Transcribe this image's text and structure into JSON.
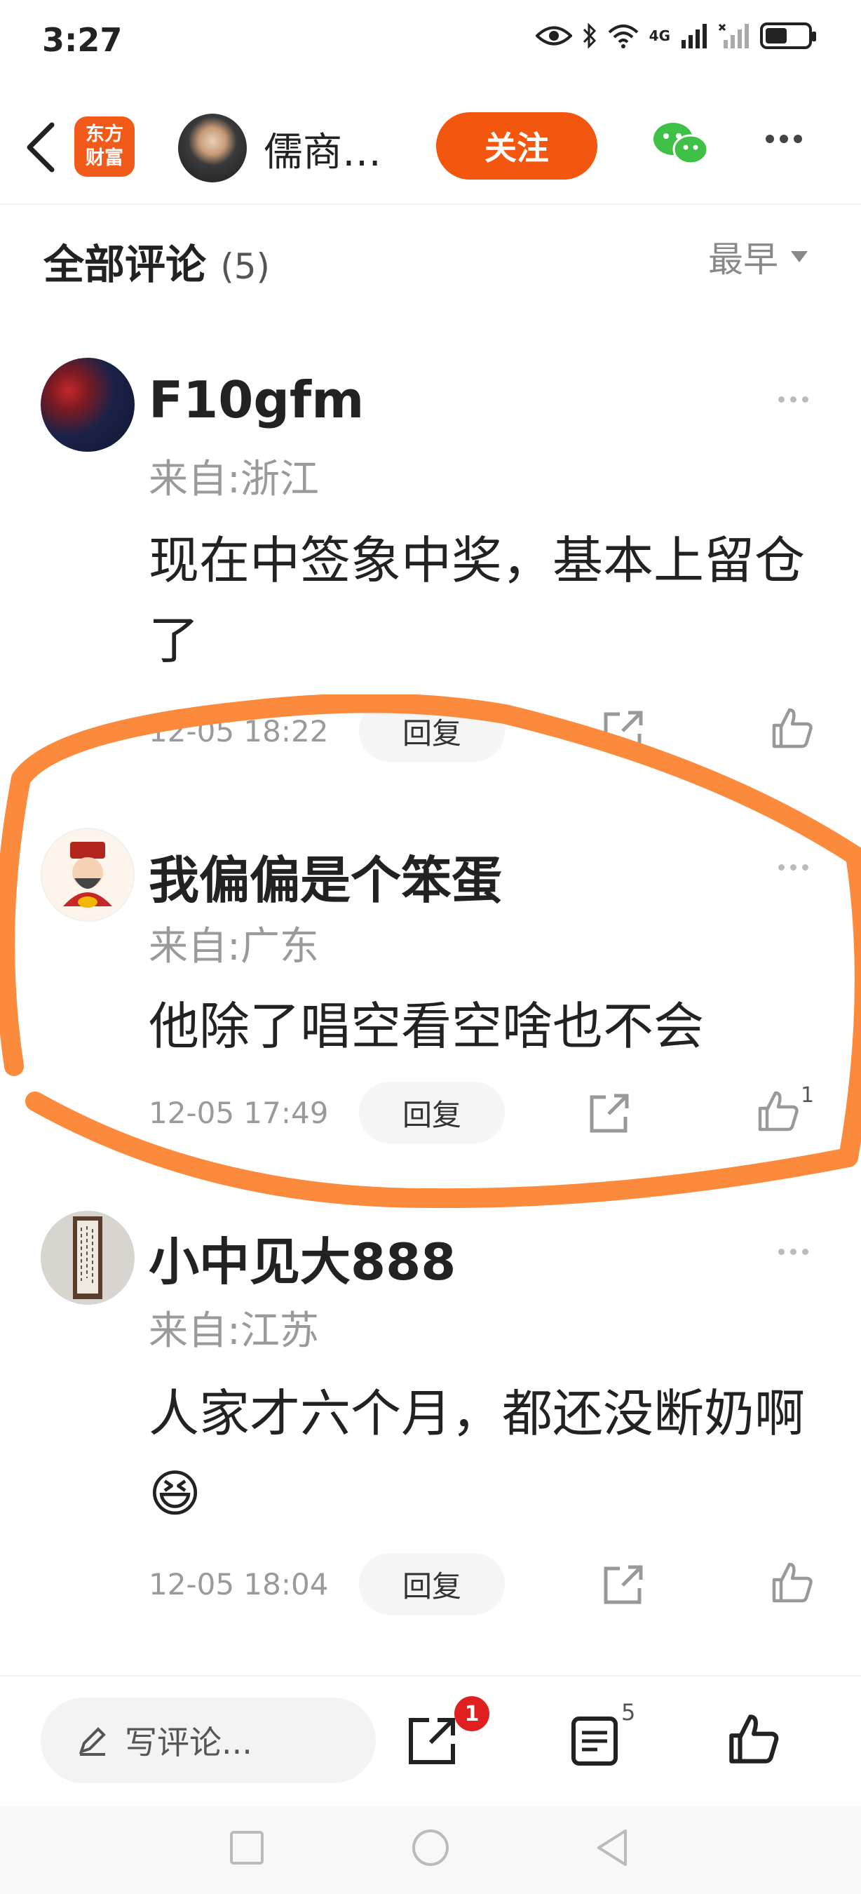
{
  "status_bar": {
    "time": "3:27",
    "network_label": "4G",
    "battery_level": 0.45
  },
  "header": {
    "app_logo_text_line1": "东方",
    "app_logo_text_line2": "财富",
    "author_name": "儒商…",
    "follow_label": "关注"
  },
  "comments_section": {
    "title": "全部评论",
    "count": "(5)",
    "sort_label": "最早"
  },
  "comments": [
    {
      "name": "F10gfm",
      "location": "来自:浙江",
      "text": "现在中签象中奖，基本上留仓了",
      "time": "12-05 18:22",
      "reply_label": "回复",
      "likes": ""
    },
    {
      "name": "我偏偏是个笨蛋",
      "location": "来自:广东",
      "text": "他除了唱空看空啥也不会",
      "time": "12-05 17:49",
      "reply_label": "回复",
      "likes": "1"
    },
    {
      "name": "小中见大888",
      "location": "来自:江苏",
      "text": "人家才六个月，都还没断奶啊😆",
      "time": "12-05 18:04",
      "reply_label": "回复",
      "likes": ""
    }
  ],
  "bottom_bar": {
    "compose_placeholder": "写评论...",
    "share_badge": "1",
    "comments_badge": "5"
  },
  "colors": {
    "accent": "#f2560f",
    "highlight_stroke": "#fb8a3c",
    "wechat": "#3fc046"
  }
}
